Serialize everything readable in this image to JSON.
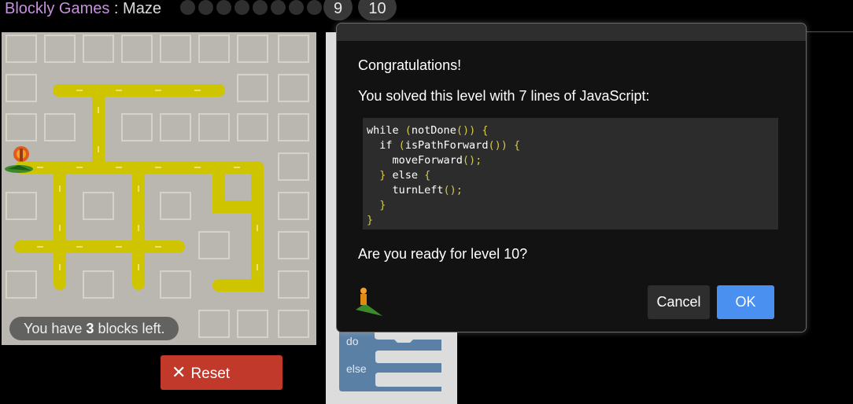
{
  "header": {
    "brand": "Blockly Games",
    "separator": " : ",
    "game": "Maze",
    "levels_completed_dots": 8,
    "current_level": "9",
    "next_level": "10"
  },
  "maze": {
    "blocks_left_prefix": "You have ",
    "blocks_left_count": "3",
    "blocks_left_suffix": " blocks left.",
    "reset_label": "Reset"
  },
  "workspace": {
    "do_label": "do",
    "else_label": "else"
  },
  "dialog": {
    "congrats": "Congratulations!",
    "solved": "You solved this level with 7 lines of JavaScript:",
    "code": [
      "while (notDone()) {",
      "  if (isPathForward()) {",
      "    moveForward();",
      "  } else {",
      "    turnLeft();",
      "  }",
      "}"
    ],
    "ready": "Are you ready for level 10?",
    "cancel_label": "Cancel",
    "ok_label": "OK"
  },
  "colors": {
    "brand": "#c890e0",
    "path": "#cfc400",
    "ok_button": "#4a90f0",
    "reset_button": "#c0392b",
    "code_punctuation": "#d3c94a"
  }
}
